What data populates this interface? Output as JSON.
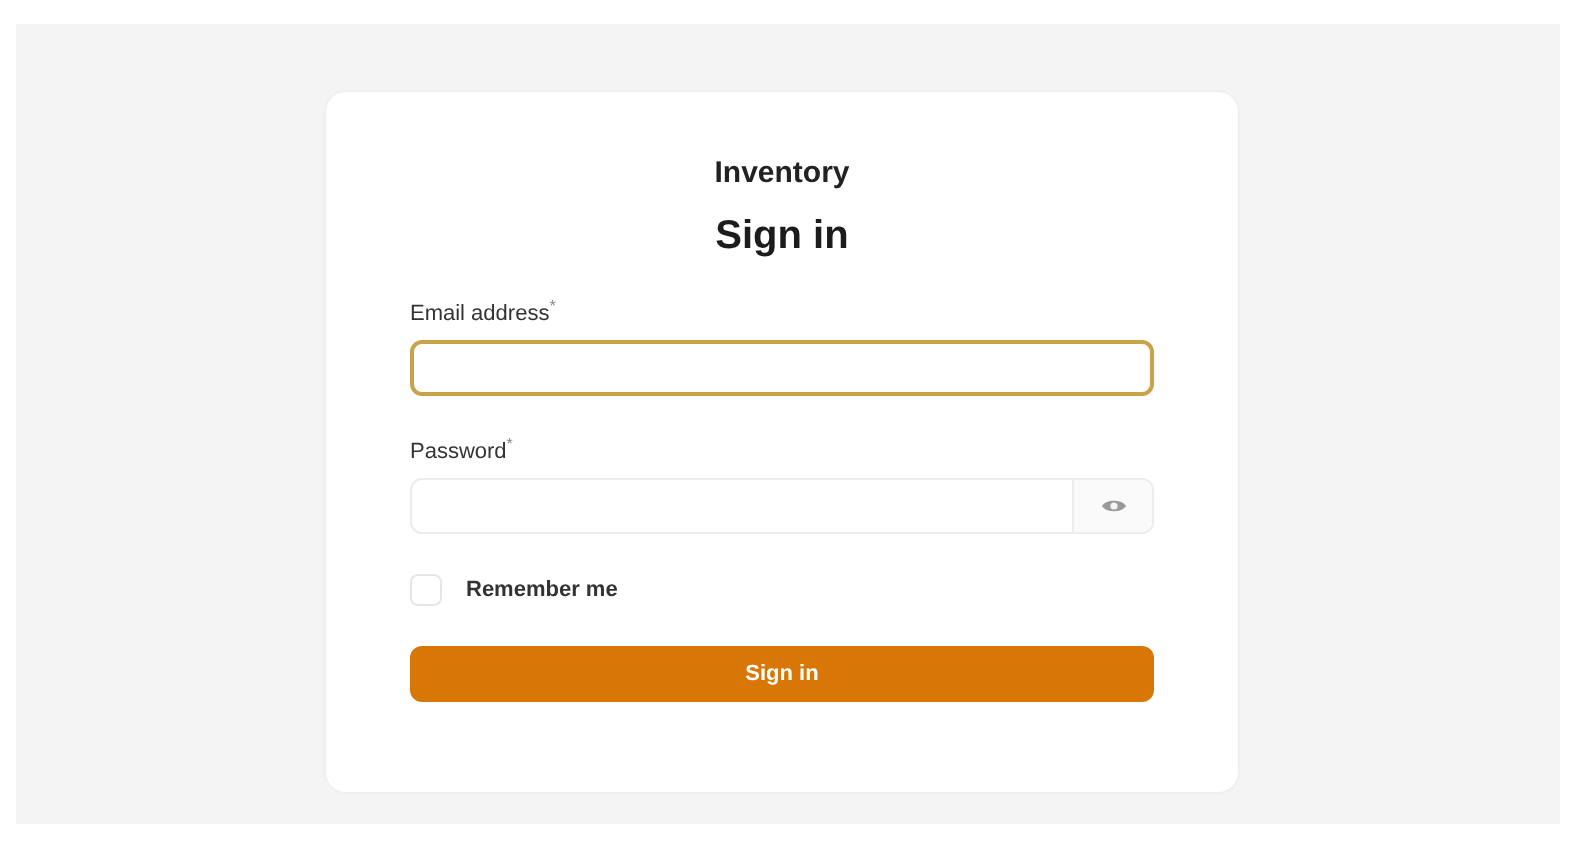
{
  "app_name": "Inventory",
  "heading": "Sign in",
  "fields": [
    {
      "kind": "text",
      "label": "Email address$^{*}$",
      "focused": true
    },
    {
      "kind": "password",
      "label": "Password$^{*}$",
      "focused": false
    }
  ],
  "remember": {
    "label": "Remember me",
    "checked": false
  },
  "submit": {
    "label": "Sign in"
  }
}
